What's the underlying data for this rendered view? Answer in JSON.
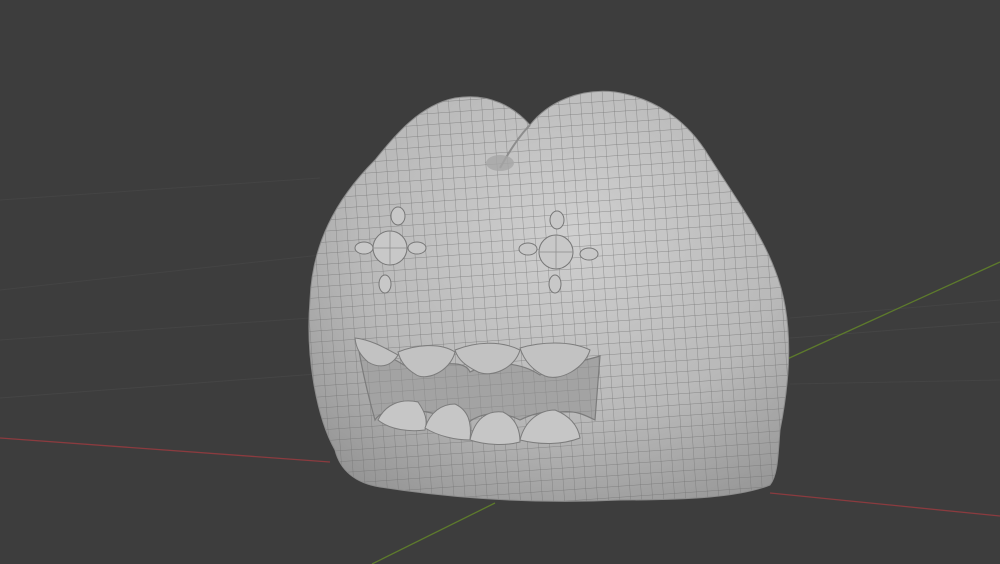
{
  "viewport": {
    "background_color": "#3d3d3d",
    "grid_color": "#464646",
    "x_axis_color": "#8b3b3f",
    "y_axis_color": "#5d7a2c",
    "model_color": "#bdbdbd",
    "wire_color": "#6e6e6e"
  },
  "model": {
    "name_icon": "monster-head-mesh",
    "features": [
      "left-eye",
      "right-eye",
      "upper-teeth",
      "lower-teeth",
      "mouth-cavity"
    ]
  }
}
